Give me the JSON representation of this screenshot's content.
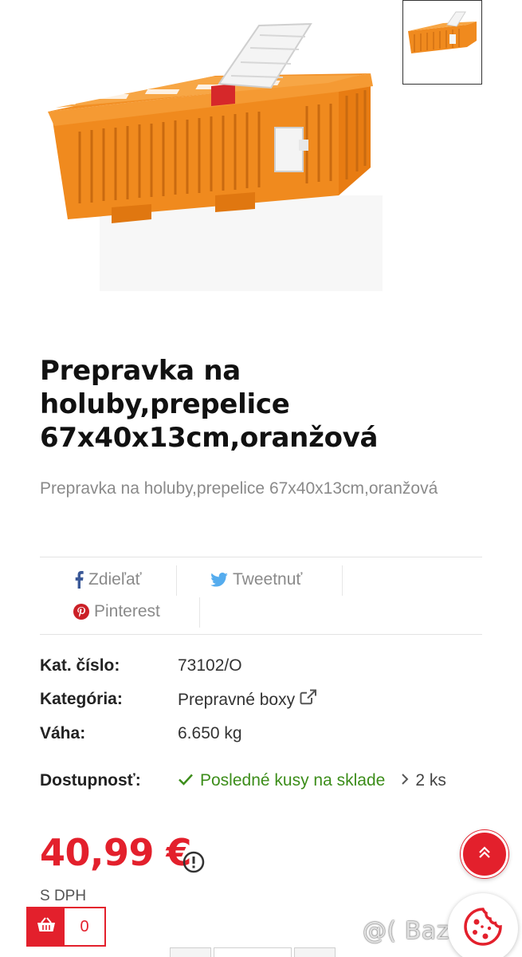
{
  "product": {
    "title": "Prepravka na holuby,prepelice 67x40x13cm,oranžová",
    "short_description": "Prepravka na holuby,prepelice 67x40x13cm,oranžová"
  },
  "share": {
    "facebook_label": "Zdieľať",
    "twitter_label": "Tweetnuť",
    "pinterest_label": "Pinterest"
  },
  "details": {
    "code_label": "Kat. číslo:",
    "code_value": "73102/O",
    "category_label": "Kategória:",
    "category_value": "Prepravné boxy",
    "weight_label": "Váha:",
    "weight_value": "6.650 kg",
    "availability_label": "Dostupnosť:",
    "availability_value": "Posledné kusy na sklade",
    "availability_count": "2 ks"
  },
  "pricing": {
    "price": "40,99 €",
    "vat_note": "S DPH"
  },
  "cart": {
    "count": "0"
  },
  "watermark": "@( Bazos.sk",
  "colors": {
    "accent": "#e3202c",
    "product_orange": "#f08a1e",
    "available_green": "#3c8d1a"
  },
  "icons": [
    "facebook-icon",
    "twitter-icon",
    "pinterest-icon",
    "external-link-icon",
    "check-icon",
    "chevron-right-icon",
    "info-icon",
    "double-chevron-up-icon",
    "basket-icon",
    "cookie-icon"
  ]
}
